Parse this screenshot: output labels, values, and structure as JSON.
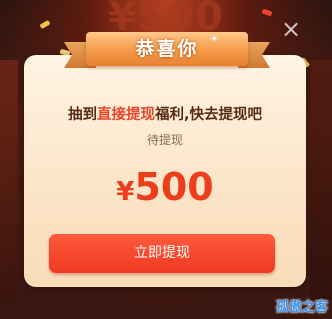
{
  "background": {
    "amount_text": "¥500"
  },
  "dialog": {
    "close_glyph": "×",
    "ribbon_title": "恭喜你",
    "headline_prefix": "抽到",
    "headline_highlight": "直接提现",
    "headline_suffix": "福利,快去提现吧",
    "pending_label": "待提现",
    "currency_symbol": "¥",
    "amount_value": "500",
    "cta_label": "立即提现"
  },
  "watermark": {
    "text": "孤傲之客"
  },
  "colors": {
    "accent_red": "#ec3d1c",
    "button_red": "#ee3a22",
    "ribbon_orange": "#f39a48",
    "card_cream": "#fff4e4",
    "watermark_blue": "#3a8ee6"
  },
  "icons": {
    "close": "close-icon",
    "sparkle": "sparkle-icon"
  }
}
